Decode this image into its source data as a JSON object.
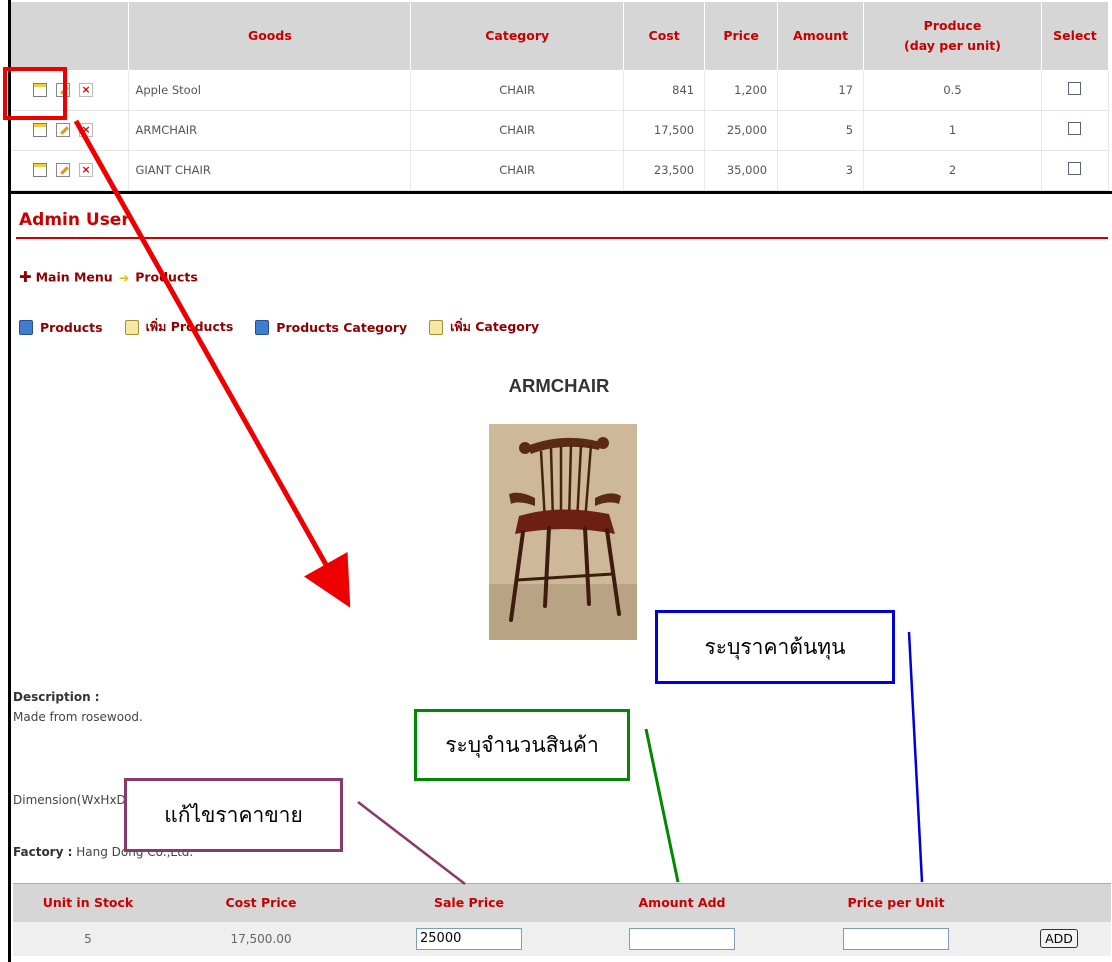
{
  "goods_table": {
    "headers": [
      "Goods",
      "Category",
      "Cost",
      "Price",
      "Amount",
      "Produce",
      "(day per unit)",
      "Select"
    ],
    "rows": [
      {
        "goods": "Apple Stool",
        "category": "CHAIR",
        "cost": "841",
        "price": "1,200",
        "amount": "17",
        "produce": "0.5"
      },
      {
        "goods": "ARMCHAIR",
        "category": "CHAIR",
        "cost": "17,500",
        "price": "25,000",
        "amount": "5",
        "produce": "1"
      },
      {
        "goods": "GIANT CHAIR",
        "category": "CHAIR",
        "cost": "23,500",
        "price": "35,000",
        "amount": "3",
        "produce": "2"
      }
    ]
  },
  "admin": {
    "title": "Admin User",
    "breadcrumb": {
      "main_menu": "Main Menu",
      "current": "Products"
    },
    "menu": [
      "Products",
      "เพิ่ม Products",
      "Products Category",
      "เพิ่ม Category"
    ]
  },
  "product": {
    "name": "ARMCHAIR",
    "description_label": "Description :",
    "description": "Made from rosewood.",
    "dimension": "Dimension(WxHxD) : 85 x 120 x 80 cm.",
    "factory_label": "Factory :",
    "factory": "Hang Dong Co.,Ltd."
  },
  "stock_table": {
    "headers": [
      "Unit in Stock",
      "Cost Price",
      "Sale Price",
      "Amount Add",
      "Price per Unit"
    ],
    "unit_in_stock": "5",
    "cost_price": "17,500.00",
    "sale_price_value": "25000",
    "amount_add_value": "",
    "price_per_unit_value": "",
    "add_button": "ADD"
  },
  "annotations": {
    "cost_note": "ระบุราคาต้นทุน",
    "amount_note": "ระบุจำนวนสินค้า",
    "price_note": "แก้ไขราคาขาย"
  },
  "colors": {
    "accent_red": "#c80000",
    "header_gray": "#d6d6d6",
    "callout_blue": "#0000dd",
    "callout_green": "#008800",
    "callout_purple": "#8a3a6a",
    "arrow_red": "#ee0000"
  }
}
